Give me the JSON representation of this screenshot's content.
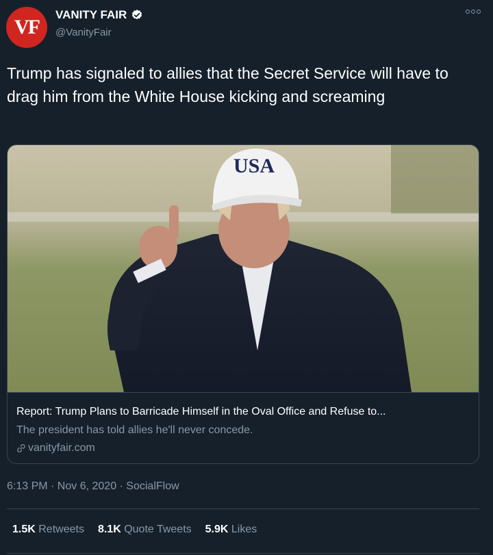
{
  "account": {
    "avatar_text": "VF",
    "name": "VANITY FAIR",
    "handle": "@VanityFair",
    "verified": true
  },
  "tweet": {
    "text": "Trump has signaled to allies that the Secret Service will have to drag him from the White House kicking and screaming",
    "timestamp": "6:13 PM · Nov 6, 2020 · SocialFlow"
  },
  "card": {
    "image_cap_text": "USA",
    "title": "Report: Trump Plans to Barricade Himself in the Oval Office and Refuse to...",
    "description": "The president has told allies he'll never concede.",
    "domain": "vanityfair.com"
  },
  "stats": {
    "retweets_count": "1.5K",
    "retweets_label": "Retweets",
    "quotes_count": "8.1K",
    "quotes_label": "Quote Tweets",
    "likes_count": "5.9K",
    "likes_label": "Likes"
  },
  "colors": {
    "background": "#15202b",
    "brand_red": "#d0261f",
    "secondary_text": "#8899a6",
    "border": "#38444d",
    "verified_badge": "#ffffff"
  }
}
